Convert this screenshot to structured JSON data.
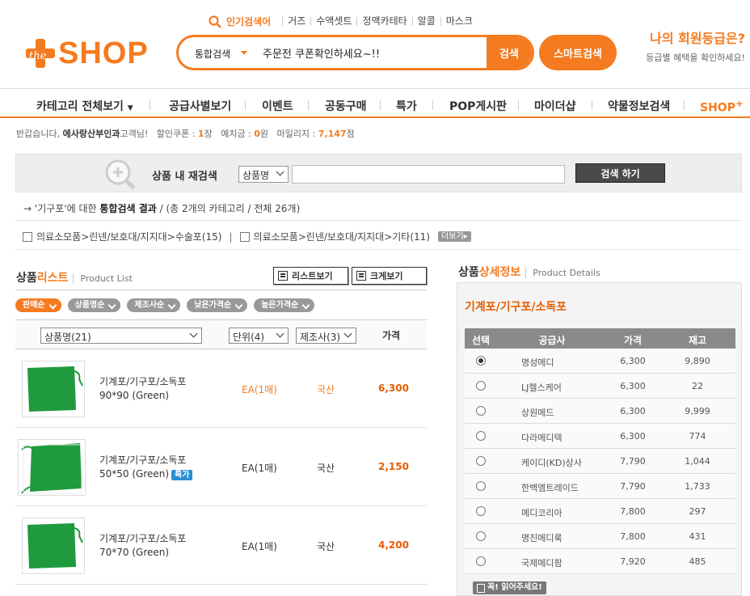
{
  "header": {
    "logo_the": "the",
    "logo_shop": "SHOP",
    "popular_label": "인기검색어",
    "popular_keywords": [
      "거즈",
      "수액셋트",
      "정맥카테타",
      "알콜",
      "마스크"
    ],
    "search_category": "통합검색",
    "search_value": "주문전 쿠폰확인하세요~!!",
    "search_button": "검색",
    "smart_search_button": "스마트검색",
    "member_title": "나의 회원등급은?",
    "member_sub": "등급별 혜택을 확인하세요!"
  },
  "nav": {
    "items": [
      "카테고리 전체보기",
      "공급사별보기",
      "이벤트",
      "공동구매",
      "특가",
      "POP게시판",
      "마이더샵",
      "약물정보검색",
      "SHOP"
    ],
    "shop_plus": "+"
  },
  "userbar": {
    "greet_pre": "반갑습니다,",
    "user_name": "에사랑산부인과",
    "greet_post": "고객님!",
    "coupon_label": "할인쿠폰 :",
    "coupon_value": "1",
    "coupon_unit": "장",
    "deposit_label": "예치금 :",
    "deposit_value": "0",
    "deposit_unit": "원",
    "mileage_label": "마일리지 :",
    "mileage_value": "7,147",
    "mileage_unit": "점"
  },
  "research": {
    "title": "상품 내 재검색",
    "field_select": "상품명",
    "input_value": "",
    "button": "검색 하기"
  },
  "result": {
    "arrow": "→",
    "keyword_text": "'기구포'에 대한",
    "bold": "통합검색 결과",
    "rest": "/ (총 2개의 카테고리 / 전체 26개)"
  },
  "categories": {
    "items": [
      "의료소모품>린넨/보호대/지지대>수술포(15)",
      "의료소모품>린넨/보호대/지지대>기타(11)"
    ],
    "separator": "|",
    "more": "더보기"
  },
  "list": {
    "title_a": "상품",
    "title_b": "리스트",
    "title_en": "Product List",
    "list_view": "리스트보기",
    "big_view": "크게보기",
    "sorts": [
      "판매순",
      "상품명순",
      "제조사순",
      "낮은가격순",
      "높은가격순"
    ],
    "filter_name": "상품명(21)",
    "filter_unit": "단위(4)",
    "filter_maker": "제조사(3)",
    "price_header": "가격",
    "rows": [
      {
        "name1": "기계포/기구포/소독포",
        "name2": "90*90 (Green)",
        "badge": "",
        "unit": "EA(1매)",
        "origin": "국산",
        "price": "6,300"
      },
      {
        "name1": "기계포/기구포/소독포",
        "name2": "50*50 (Green)",
        "badge": "특가",
        "unit": "EA(1매)",
        "origin": "국산",
        "price": "2,150"
      },
      {
        "name1": "기계포/기구포/소독포",
        "name2": "70*70 (Green)",
        "badge": "",
        "unit": "EA(1매)",
        "origin": "국산",
        "price": "4,200"
      }
    ]
  },
  "detail": {
    "title_a": "상품",
    "title_b": "상세정보",
    "title_en": "Product Details",
    "product_name": "기계포/기구포/소독포",
    "headers": [
      "선택",
      "공급사",
      "가격",
      "재고"
    ],
    "suppliers": [
      {
        "name": "명성메디",
        "price": "6,300",
        "stock": "9,890",
        "selected": true
      },
      {
        "name": "LJ헬스케어",
        "price": "6,300",
        "stock": "22",
        "selected": false
      },
      {
        "name": "상원메드",
        "price": "6,300",
        "stock": "9,999",
        "selected": false
      },
      {
        "name": "다라메디텍",
        "price": "6,300",
        "stock": "774",
        "selected": false
      },
      {
        "name": "케이디(KD)상사",
        "price": "7,790",
        "stock": "1,044",
        "selected": false
      },
      {
        "name": "한백엠트레이드",
        "price": "7,790",
        "stock": "1,733",
        "selected": false
      },
      {
        "name": "메디코리아",
        "price": "7,800",
        "stock": "297",
        "selected": false
      },
      {
        "name": "명진메디룩",
        "price": "7,800",
        "stock": "431",
        "selected": false
      },
      {
        "name": "국제메디팜",
        "price": "7,920",
        "stock": "485",
        "selected": false
      }
    ],
    "notice": "꼭! 읽어주세요!"
  },
  "colors": {
    "accent": "#f47b20",
    "price": "#e65c00",
    "badge": "#2a8fd6",
    "cloth": "#1f9a3c"
  }
}
